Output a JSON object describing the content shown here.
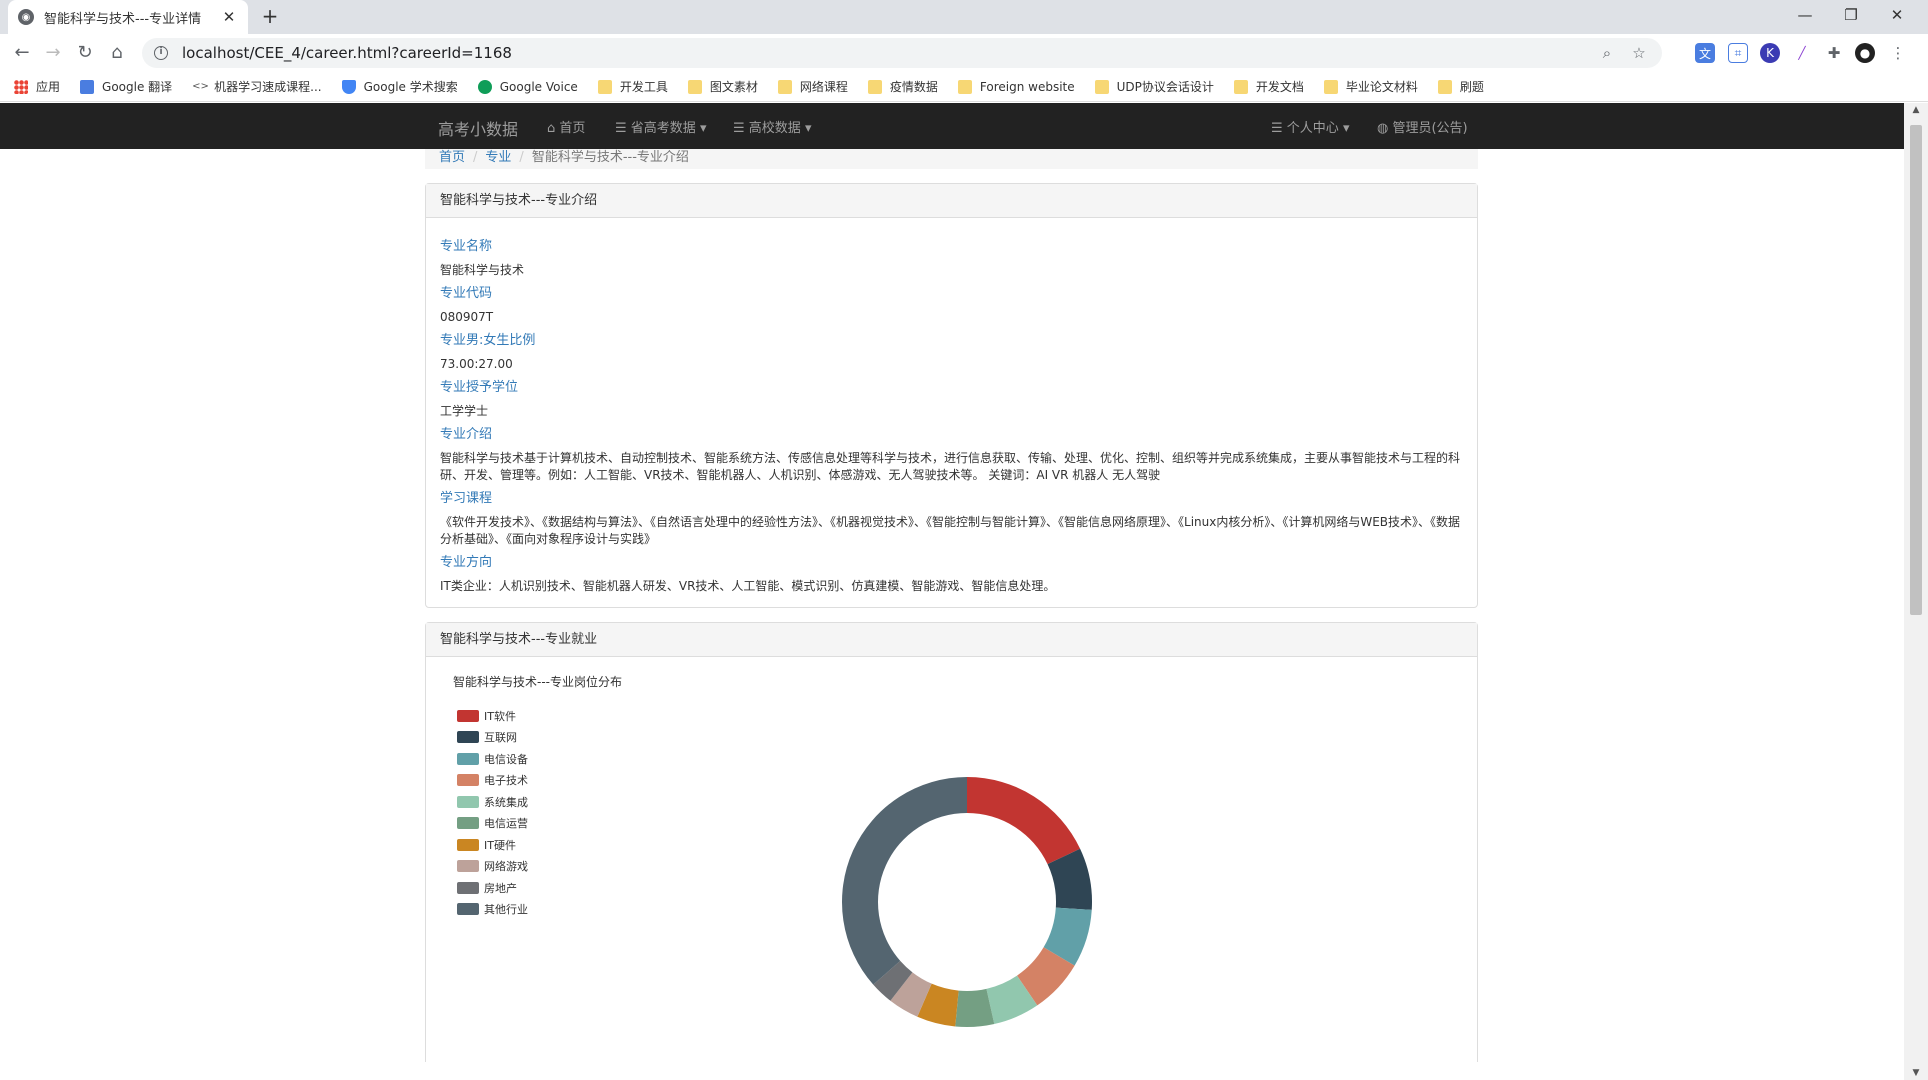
{
  "browser": {
    "tab_title": "智能科学与技术---专业详情",
    "url": "localhost/CEE_4/career.html?careerId=1168",
    "bookmarks": [
      {
        "label": "应用",
        "icon": "apps-icon"
      },
      {
        "label": "Google 翻译",
        "icon": "translate-icon"
      },
      {
        "label": "机器学习速成课程...",
        "icon": "code-icon"
      },
      {
        "label": "Google 学术搜索",
        "icon": "scholar-icon"
      },
      {
        "label": "Google Voice",
        "icon": "phone-icon"
      },
      {
        "label": "开发工具",
        "icon": "folder-icon"
      },
      {
        "label": "图文素材",
        "icon": "folder-icon"
      },
      {
        "label": "网络课程",
        "icon": "folder-icon"
      },
      {
        "label": "疫情数据",
        "icon": "folder-icon"
      },
      {
        "label": "Foreign website",
        "icon": "folder-icon"
      },
      {
        "label": "UDP协议会话设计",
        "icon": "folder-icon"
      },
      {
        "label": "开发文档",
        "icon": "folder-icon"
      },
      {
        "label": "毕业论文材料",
        "icon": "folder-icon"
      },
      {
        "label": "刷题",
        "icon": "folder-icon"
      }
    ]
  },
  "navbar": {
    "brand": "高考小数据",
    "home": "首页",
    "province": "省高考数据",
    "college": "高校数据",
    "personal": "个人中心",
    "admin": "管理员(公告)"
  },
  "breadcrumb": {
    "home": "首页",
    "major": "专业",
    "current": "智能科学与技术---专业介绍"
  },
  "intro": {
    "heading": "智能科学与技术---专业介绍",
    "fields": [
      {
        "label": "专业名称",
        "value": "智能科学与技术"
      },
      {
        "label": "专业代码",
        "value": "080907T"
      },
      {
        "label": "专业男:女生比例",
        "value": "73.00:27.00"
      },
      {
        "label": "专业授予学位",
        "value": "工学学士"
      },
      {
        "label": "专业介绍",
        "value": "智能科学与技术基于计算机技术、自动控制技术、智能系统方法、传感信息处理等科学与技术，进行信息获取、传输、处理、优化、控制、组织等并完成系统集成，主要从事智能技术与工程的科研、开发、管理等。例如：人工智能、VR技术、智能机器人、人机识别、体感游戏、无人驾驶技术等。 关键词：AI VR 机器人 无人驾驶"
      },
      {
        "label": "学习课程",
        "value": "《软件开发技术》、《数据结构与算法》、《自然语言处理中的经验性方法》、《机器视觉技术》、《智能控制与智能计算》、《智能信息网络原理》、《Linux内核分析》、《计算机网络与WEB技术》、《数据分析基础》、《面向对象程序设计与实践》"
      },
      {
        "label": "专业方向",
        "value": "IT类企业：人机识别技术、智能机器人研发、VR技术、人工智能、模式识别、仿真建模、智能游戏、智能信息处理。"
      }
    ]
  },
  "employment": {
    "heading": "智能科学与技术---专业就业"
  },
  "chart_data": {
    "type": "pie",
    "title": "智能科学与技术---专业岗位分布",
    "categories": [
      "IT软件",
      "互联网",
      "电信设备",
      "电子技术",
      "系统集成",
      "电信运营",
      "IT硬件",
      "网络游戏",
      "房地产",
      "其他行业"
    ],
    "values": [
      18,
      8,
      7.5,
      7,
      6,
      5,
      5,
      4,
      3,
      36.5
    ],
    "colors": [
      "#c23531",
      "#2f4554",
      "#61a0a8",
      "#d48265",
      "#91c7ae",
      "#749f83",
      "#ca8622",
      "#bda29a",
      "#6e7074",
      "#546570"
    ],
    "legend": "top-left",
    "donut": true
  }
}
